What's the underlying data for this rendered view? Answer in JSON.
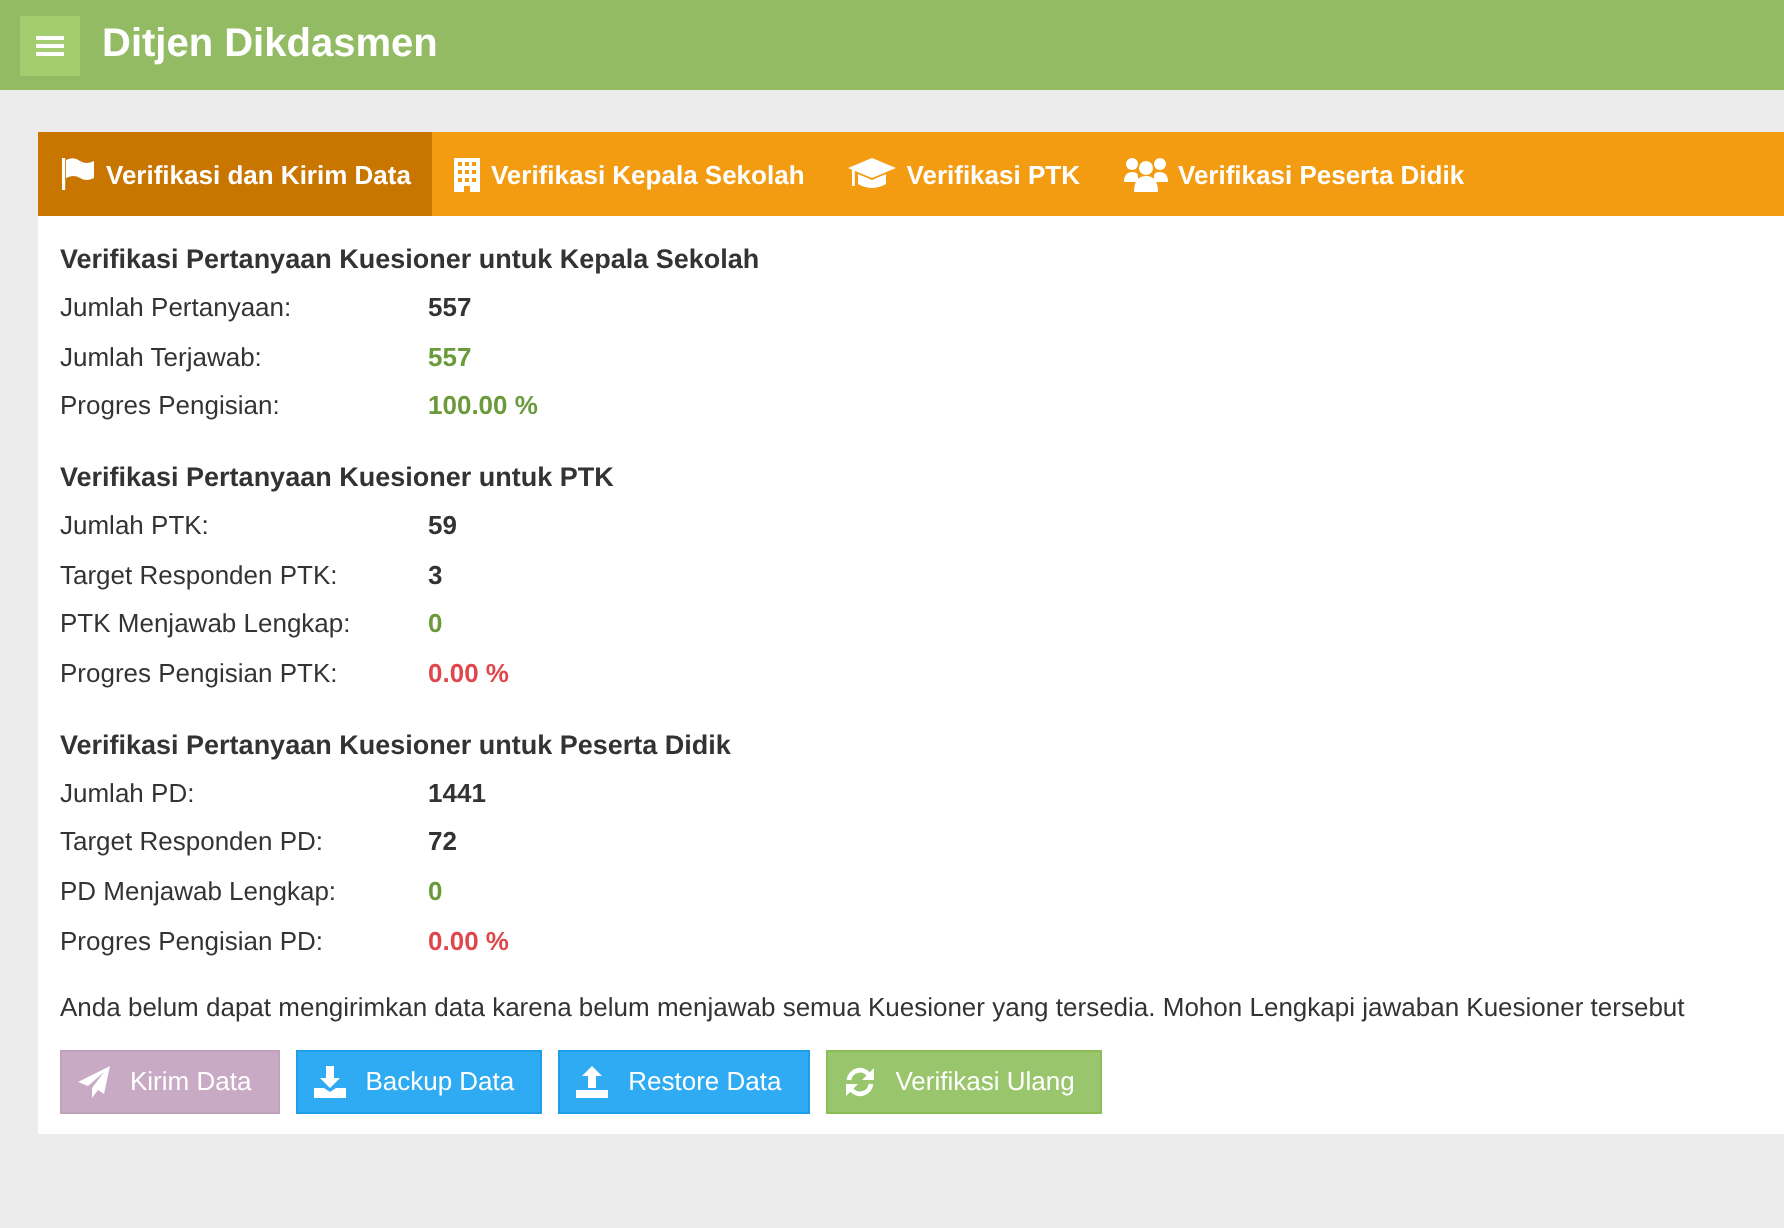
{
  "header": {
    "title": "Ditjen Dikdasmen"
  },
  "tabs": [
    {
      "label": "Verifikasi dan Kirim Data",
      "kind": "flag",
      "selected": true
    },
    {
      "label": "Verifikasi Kepala Sekolah",
      "kind": "building",
      "selected": false
    },
    {
      "label": "Verifikasi PTK",
      "kind": "cap",
      "selected": false
    },
    {
      "label": "Verifikasi Peserta Didik",
      "kind": "users",
      "selected": false
    }
  ],
  "sections": [
    {
      "title": "Verifikasi Pertanyaan Kuesioner untuk Kepala Sekolah",
      "rows": [
        {
          "label": "Jumlah Pertanyaan:",
          "value": "557",
          "kind": "plain"
        },
        {
          "label": "Jumlah Terjawab:",
          "value": "557",
          "kind": "good"
        },
        {
          "label": "Progres Pengisian:",
          "value": "100.00 %",
          "kind": "good"
        }
      ]
    },
    {
      "title": "Verifikasi Pertanyaan Kuesioner untuk PTK",
      "rows": [
        {
          "label": "Jumlah PTK:",
          "value": "59",
          "kind": "plain"
        },
        {
          "label": "Target Responden PTK:",
          "value": "3",
          "kind": "plain"
        },
        {
          "label": "PTK Menjawab Lengkap:",
          "value": "0",
          "kind": "good"
        },
        {
          "label": "Progres Pengisian PTK:",
          "value": "0.00 %",
          "kind": "bad"
        }
      ]
    },
    {
      "title": "Verifikasi Pertanyaan Kuesioner untuk Peserta Didik",
      "rows": [
        {
          "label": "Jumlah PD:",
          "value": "1441",
          "kind": "plain"
        },
        {
          "label": "Target Responden PD:",
          "value": "72",
          "kind": "plain"
        },
        {
          "label": "PD Menjawab Lengkap:",
          "value": "0",
          "kind": "good"
        },
        {
          "label": "Progres Pengisian PD:",
          "value": "0.00 %",
          "kind": "bad"
        }
      ]
    }
  ],
  "notice": "Anda belum dapat mengirimkan data karena belum menjawab semua Kuesioner yang tersedia. Mohon Lengkapi jawaban Kuesioner tersebut",
  "buttons": [
    {
      "label": "Kirim Data",
      "kind": "send",
      "disabled": true
    },
    {
      "label": "Backup Data",
      "kind": "backup",
      "disabled": false
    },
    {
      "label": "Restore Data",
      "kind": "restore",
      "disabled": false
    },
    {
      "label": "Verifikasi Ulang",
      "kind": "verify",
      "disabled": false
    }
  ]
}
